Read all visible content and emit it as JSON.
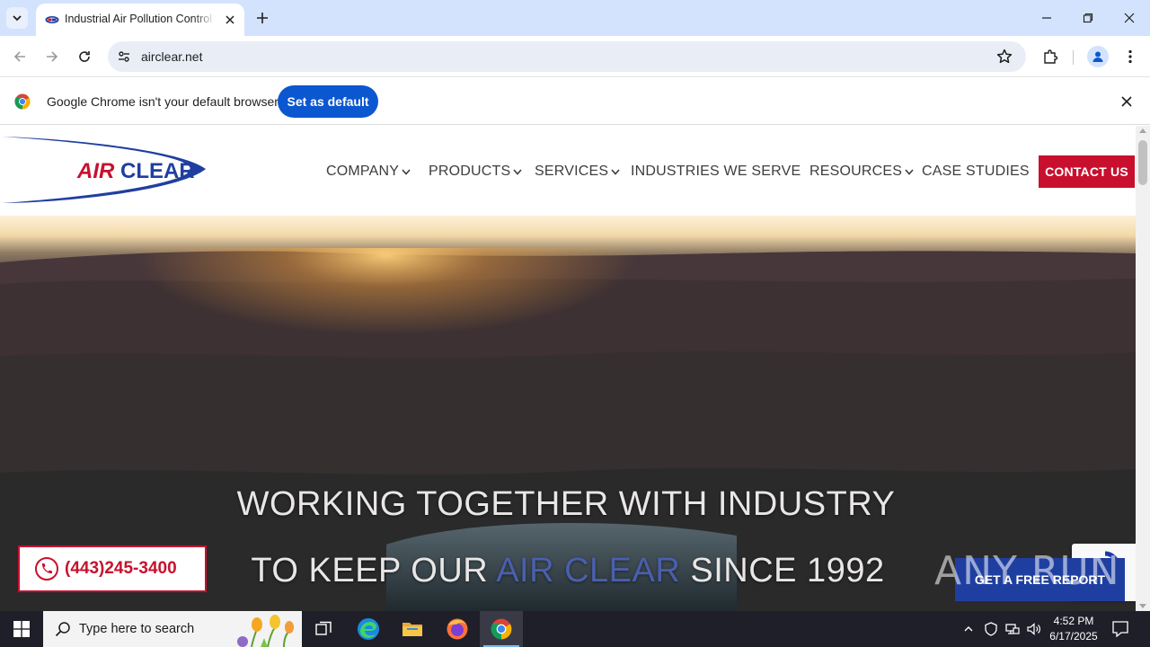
{
  "browser": {
    "tab_title": "Industrial Air Pollution Control",
    "url": "airclear.net",
    "infobar_text": "Google Chrome isn't your default browser",
    "infobar_button": "Set as default"
  },
  "site": {
    "logo_text": {
      "part1": "AIR",
      "part2": "CLEAR"
    },
    "nav": [
      {
        "label": "COMPANY",
        "has_dropdown": true
      },
      {
        "label": "PRODUCTS",
        "has_dropdown": true
      },
      {
        "label": "SERVICES",
        "has_dropdown": true
      },
      {
        "label": "INDUSTRIES WE SERVE",
        "has_dropdown": false
      },
      {
        "label": "RESOURCES",
        "has_dropdown": true
      },
      {
        "label": "CASE STUDIES",
        "has_dropdown": false
      }
    ],
    "contact_button": "CONTACT US",
    "hero": {
      "line1": "WORKING TOGETHER WITH INDUSTRY",
      "line2_prefix": "TO KEEP OUR ",
      "line2_accent": "AIR CLEAR",
      "line2_suffix": " SINCE 1992"
    },
    "phone": "(443)245-3400",
    "free_report_button": "GET A FREE REPORT"
  },
  "watermark": "ANY RUN",
  "taskbar": {
    "search_placeholder": "Type here to search",
    "time": "4:52 PM",
    "date": "6/17/2025"
  },
  "colors": {
    "brand_red": "#c8102e",
    "brand_blue": "#1f3fa0",
    "chrome_blue": "#0b57d0",
    "tabstrip": "#d3e3fd"
  }
}
